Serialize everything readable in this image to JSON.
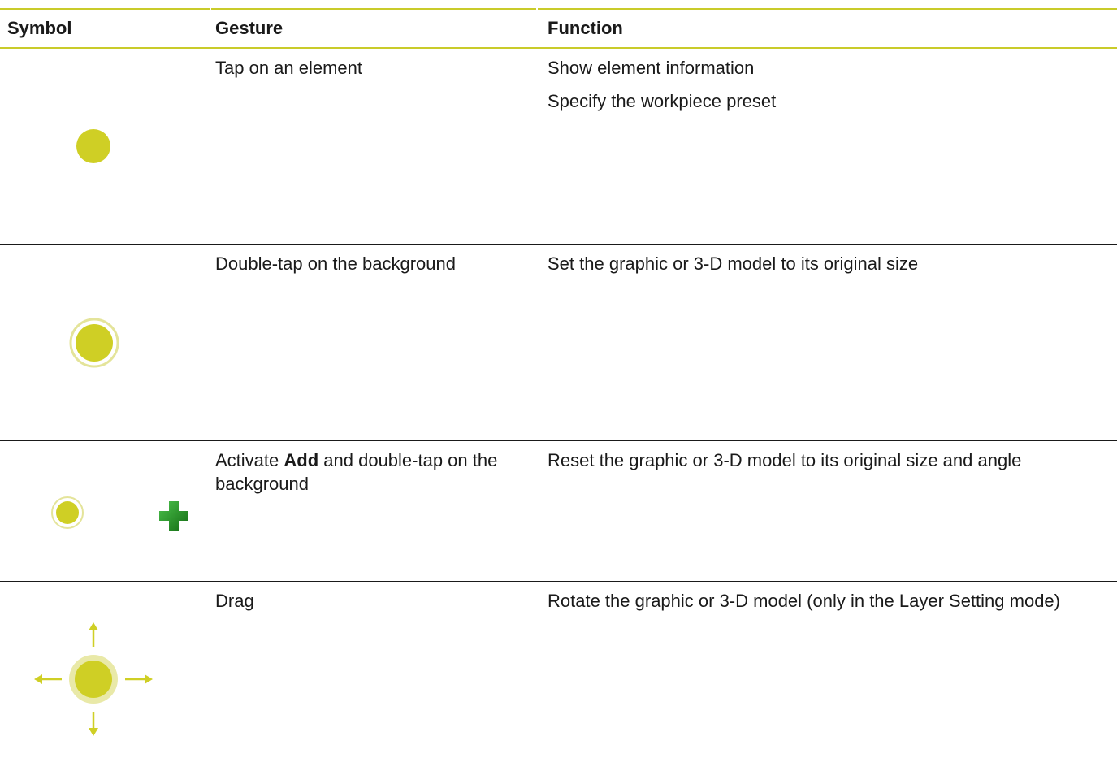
{
  "table": {
    "headers": {
      "symbol": "Symbol",
      "gesture": "Gesture",
      "function": "Function"
    },
    "rows": [
      {
        "symbol_icon": "tap-icon",
        "gesture": "Tap on an element",
        "functions": [
          "Show element information",
          "Specify the workpiece preset"
        ]
      },
      {
        "symbol_icon": "double-tap-icon",
        "gesture": "Double-tap on the background",
        "functions": [
          "Set the graphic or 3-D model to its original size"
        ]
      },
      {
        "symbol_icon": "double-tap-icon",
        "symbol_icon_2": "add-plus-icon",
        "gesture_pre": "Activate",
        "gesture_bold": "Add",
        "gesture_post": "and double-tap on the background",
        "functions": [
          "Reset the graphic or 3-D model to its original size and angle"
        ]
      },
      {
        "symbol_icon": "drag-icon",
        "gesture": "Drag",
        "functions": [
          "Rotate the graphic or 3-D model (only in the Layer Setting mode)"
        ]
      }
    ]
  },
  "colors": {
    "accent": "#c9cb2a",
    "ring": "#e6e6a0",
    "plus_green": "#2a9a2a",
    "text": "#1a1a1a"
  }
}
